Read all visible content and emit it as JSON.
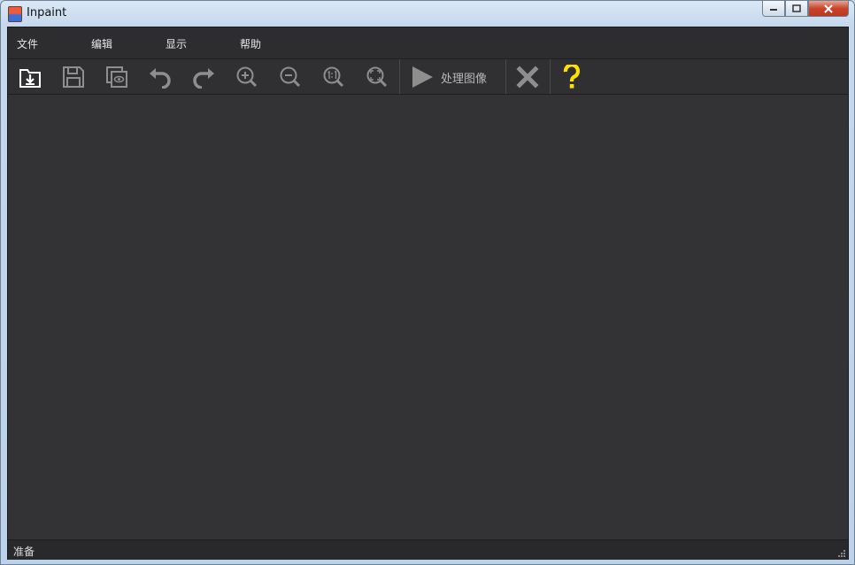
{
  "window": {
    "title": "Inpaint"
  },
  "menu": {
    "items": [
      "文件",
      "编辑",
      "显示",
      "帮助"
    ]
  },
  "toolbar": {
    "process_label": "处理图像",
    "icons": [
      "open-file-icon",
      "save-icon",
      "preview-icon",
      "undo-icon",
      "redo-icon",
      "zoom-in-icon",
      "zoom-out-icon",
      "zoom-actual-icon",
      "zoom-fit-icon",
      "play-icon",
      "close-x-icon",
      "help-icon"
    ],
    "colors": {
      "icon_bright": "#ffffff",
      "icon_dim": "#8e8e8e",
      "help": "#ffe000"
    }
  },
  "status": {
    "text": "准备"
  }
}
